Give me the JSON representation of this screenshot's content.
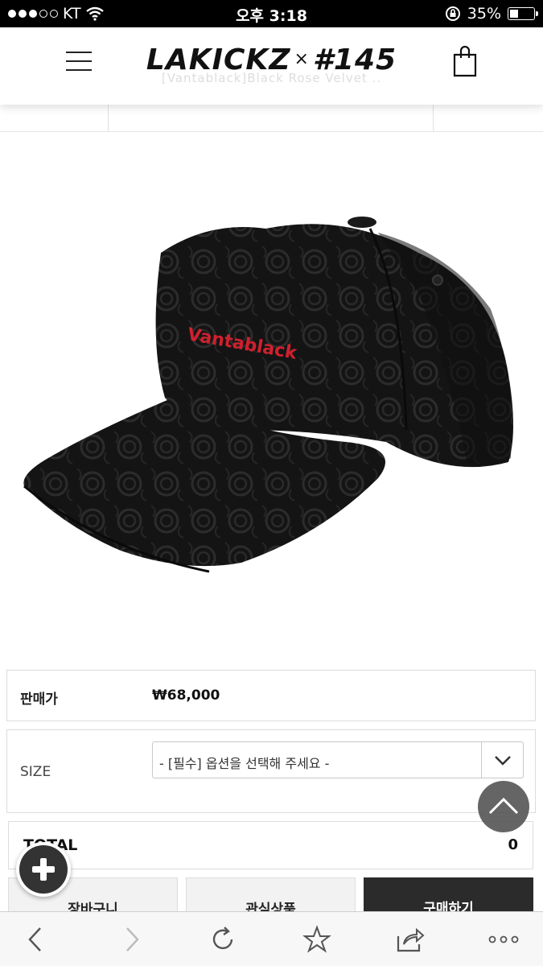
{
  "status_bar": {
    "carrier": "KT",
    "time": "오후 3:18",
    "battery": "35%",
    "battery_level": 0.35
  },
  "header": {
    "brand_left": "LAKICKZ",
    "brand_x": "×",
    "brand_right": "#145",
    "subtitle": "[Vantablack]Black Rose Velvet .."
  },
  "product": {
    "cap_embroidery": "Vantablack",
    "price_label": "판매가",
    "price_value": "₩68,000",
    "size_label": "SIZE",
    "size_select_value": "- [필수] 옵션을 선택해 주세요 -",
    "total_label": "TOTAL",
    "total_value": "0"
  },
  "actions": {
    "cart_label": "장바구니",
    "wish_label": "관심상품",
    "buy_label": "구매하기"
  },
  "icons": [
    "menu-icon",
    "cart-icon",
    "chevron-down-icon",
    "arrow-up-icon",
    "plus-icon",
    "back-icon",
    "forward-icon",
    "reload-icon",
    "star-icon",
    "share-icon",
    "more-icon"
  ],
  "colors": {
    "buy_button": "#2b2b2b",
    "embroidery": "#d0202e"
  }
}
